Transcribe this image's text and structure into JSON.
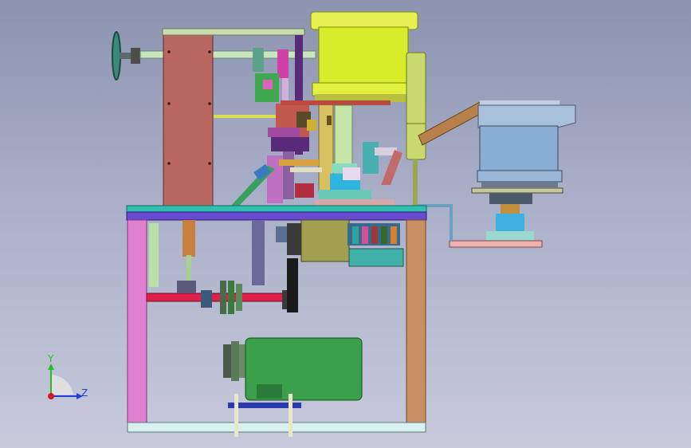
{
  "triad": {
    "y_label": "Y",
    "z_label": "Z",
    "colors": {
      "y": "#22c02a",
      "z": "#1f3fd6",
      "origin": "#d11a1a"
    }
  }
}
